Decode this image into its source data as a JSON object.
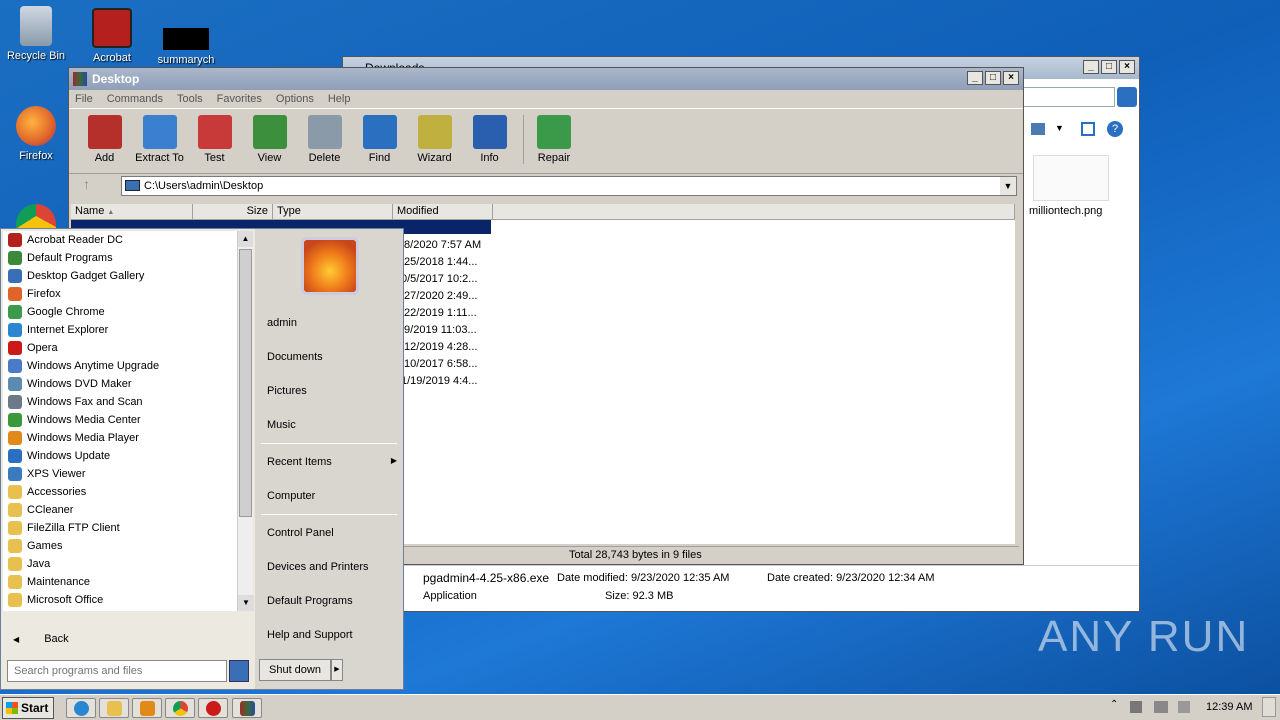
{
  "desktop_icons": {
    "recycle_bin": "Recycle Bin",
    "acrobat": "Acrobat",
    "summary": "summarych",
    "firefox": "Firefox"
  },
  "explorer_bg": {
    "title": "Downloads",
    "file_label": "milliontech.png",
    "details": {
      "filename": "pgadmin4-4.25-x86.exe",
      "date_modified": "Date modified: 9/23/2020 12:35 AM",
      "date_created": "Date created: 9/23/2020 12:34 AM",
      "type": "Application",
      "size": "Size: 92.3 MB"
    }
  },
  "winrar": {
    "title": "Desktop",
    "menu": [
      "File",
      "Commands",
      "Tools",
      "Favorites",
      "Options",
      "Help"
    ],
    "tools": [
      {
        "label": "Add",
        "color": "#b5302a"
      },
      {
        "label": "Extract To",
        "color": "#3a7fd0"
      },
      {
        "label": "Test",
        "color": "#c83a3a"
      },
      {
        "label": "View",
        "color": "#3c8f3c"
      },
      {
        "label": "Delete",
        "color": "#8a9aa8"
      },
      {
        "label": "Find",
        "color": "#2a6fc0"
      },
      {
        "label": "Wizard",
        "color": "#c0b040"
      },
      {
        "label": "Info",
        "color": "#2a5fb0"
      },
      {
        "label": "Repair",
        "color": "#3a9a4a"
      }
    ],
    "address": "C:\\Users\\admin\\Desktop",
    "columns": {
      "name": "Name",
      "size": "Size",
      "type": "Type",
      "modified": "Modified"
    },
    "modified_values": [
      "/8/2020 7:57 AM",
      "/25/2018 1:44...",
      "0/5/2017 10:2...",
      "/27/2020 2:49...",
      "/22/2019 1:11...",
      "/9/2019 11:03...",
      "/12/2019 4:28...",
      "/10/2017 6:58...",
      "1/19/2019 4:4..."
    ],
    "status": "Total 28,743 bytes in 9 files"
  },
  "start_menu": {
    "programs": [
      {
        "label": "Acrobat Reader DC",
        "color": "#b3201d"
      },
      {
        "label": "Default Programs",
        "color": "#3a8a3a"
      },
      {
        "label": "Desktop Gadget Gallery",
        "color": "#3a6fb8"
      },
      {
        "label": "Firefox",
        "color": "#e0642a"
      },
      {
        "label": "Google Chrome",
        "color": "#3c9a4a"
      },
      {
        "label": "Internet Explorer",
        "color": "#2a86d0"
      },
      {
        "label": "Opera",
        "color": "#cc1a1a"
      },
      {
        "label": "Windows Anytime Upgrade",
        "color": "#4a7ac8"
      },
      {
        "label": "Windows DVD Maker",
        "color": "#5a8ab0"
      },
      {
        "label": "Windows Fax and Scan",
        "color": "#6a7a8a"
      },
      {
        "label": "Windows Media Center",
        "color": "#3a9a3a"
      },
      {
        "label": "Windows Media Player",
        "color": "#e08a1a"
      },
      {
        "label": "Windows Update",
        "color": "#2a6fc0"
      },
      {
        "label": "XPS Viewer",
        "color": "#3a7ac0"
      },
      {
        "label": "Accessories",
        "color": "#e8c050"
      },
      {
        "label": "CCleaner",
        "color": "#e8c050"
      },
      {
        "label": "FileZilla FTP Client",
        "color": "#e8c050"
      },
      {
        "label": "Games",
        "color": "#e8c050"
      },
      {
        "label": "Java",
        "color": "#e8c050"
      },
      {
        "label": "Maintenance",
        "color": "#e8c050"
      },
      {
        "label": "Microsoft Office",
        "color": "#e8c050"
      }
    ],
    "back": "Back",
    "search_placeholder": "Search programs and files",
    "user": "admin",
    "links_top": [
      "Documents",
      "Pictures",
      "Music"
    ],
    "recent_items": "Recent Items",
    "computer": "Computer",
    "links_bottom": [
      "Control Panel",
      "Devices and Printers",
      "Default Programs",
      "Help and Support"
    ],
    "shutdown": "Shut down"
  },
  "taskbar": {
    "start": "Start",
    "clock": "12:39 AM"
  },
  "watermark": "ANY RUN"
}
